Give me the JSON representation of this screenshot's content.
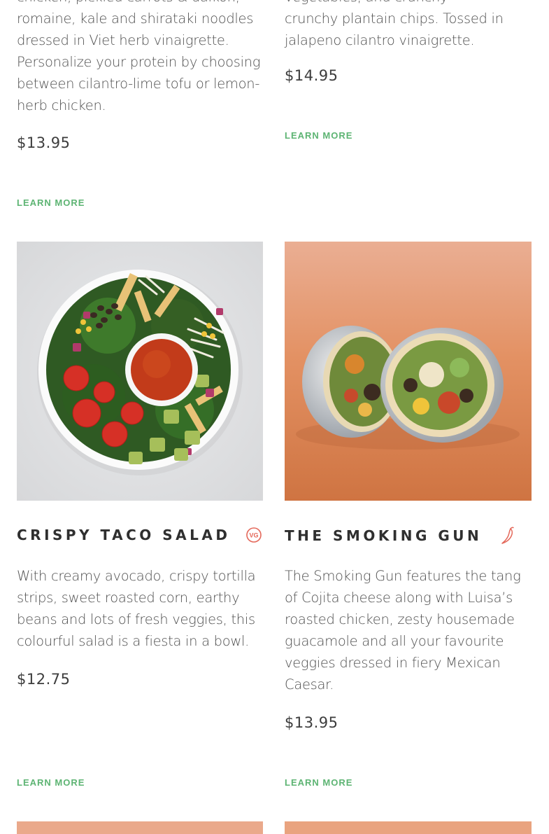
{
  "top_left": {
    "desc_lines": [
      "chicken, pickled carrots & daikon,",
      "romaine, kale and shirataki noodles",
      "dressed in Viet herb vinaigrette.",
      "Personalize your protein by choosing",
      "between cilantro-lime tofu or lemon-",
      "herb chicken."
    ],
    "price": "$13.95",
    "learn_more": "LEARN MORE"
  },
  "top_right": {
    "desc_lines": [
      "vegetables, and crunchy",
      "crunchy plantain chips. Tossed in",
      "jalapeno cilantro vinaigrette."
    ],
    "price": "$14.95",
    "learn_more": "LEARN MORE"
  },
  "items": [
    {
      "title": "CRISPY TACO SALAD",
      "badge": "VG",
      "badge_icon": "vegetarian-badge-icon",
      "desc_lines": [
        "With creamy avocado, crispy tortilla",
        "strips, sweet roasted corn, earthy",
        "beans and lots of fresh veggies, this",
        "colourful salad is a fiesta in a bowl."
      ],
      "price": "$12.75",
      "learn_more": "LEARN MORE"
    },
    {
      "title": "THE SMOKING GUN",
      "badge_icon": "chili-pepper-icon",
      "desc_lines": [
        "The Smoking Gun features the tang",
        "of Cojita cheese along with Luisa’s",
        "roasted chicken, zesty housemade",
        "guacamole and all your favourite",
        "veggies dressed in fiery Mexican",
        "Caesar."
      ],
      "price": "$13.95",
      "learn_more": "LEARN MORE"
    }
  ],
  "colors": {
    "accent_green": "#5db473",
    "badge_red": "#e4685a",
    "text": "#4f4f4f"
  }
}
